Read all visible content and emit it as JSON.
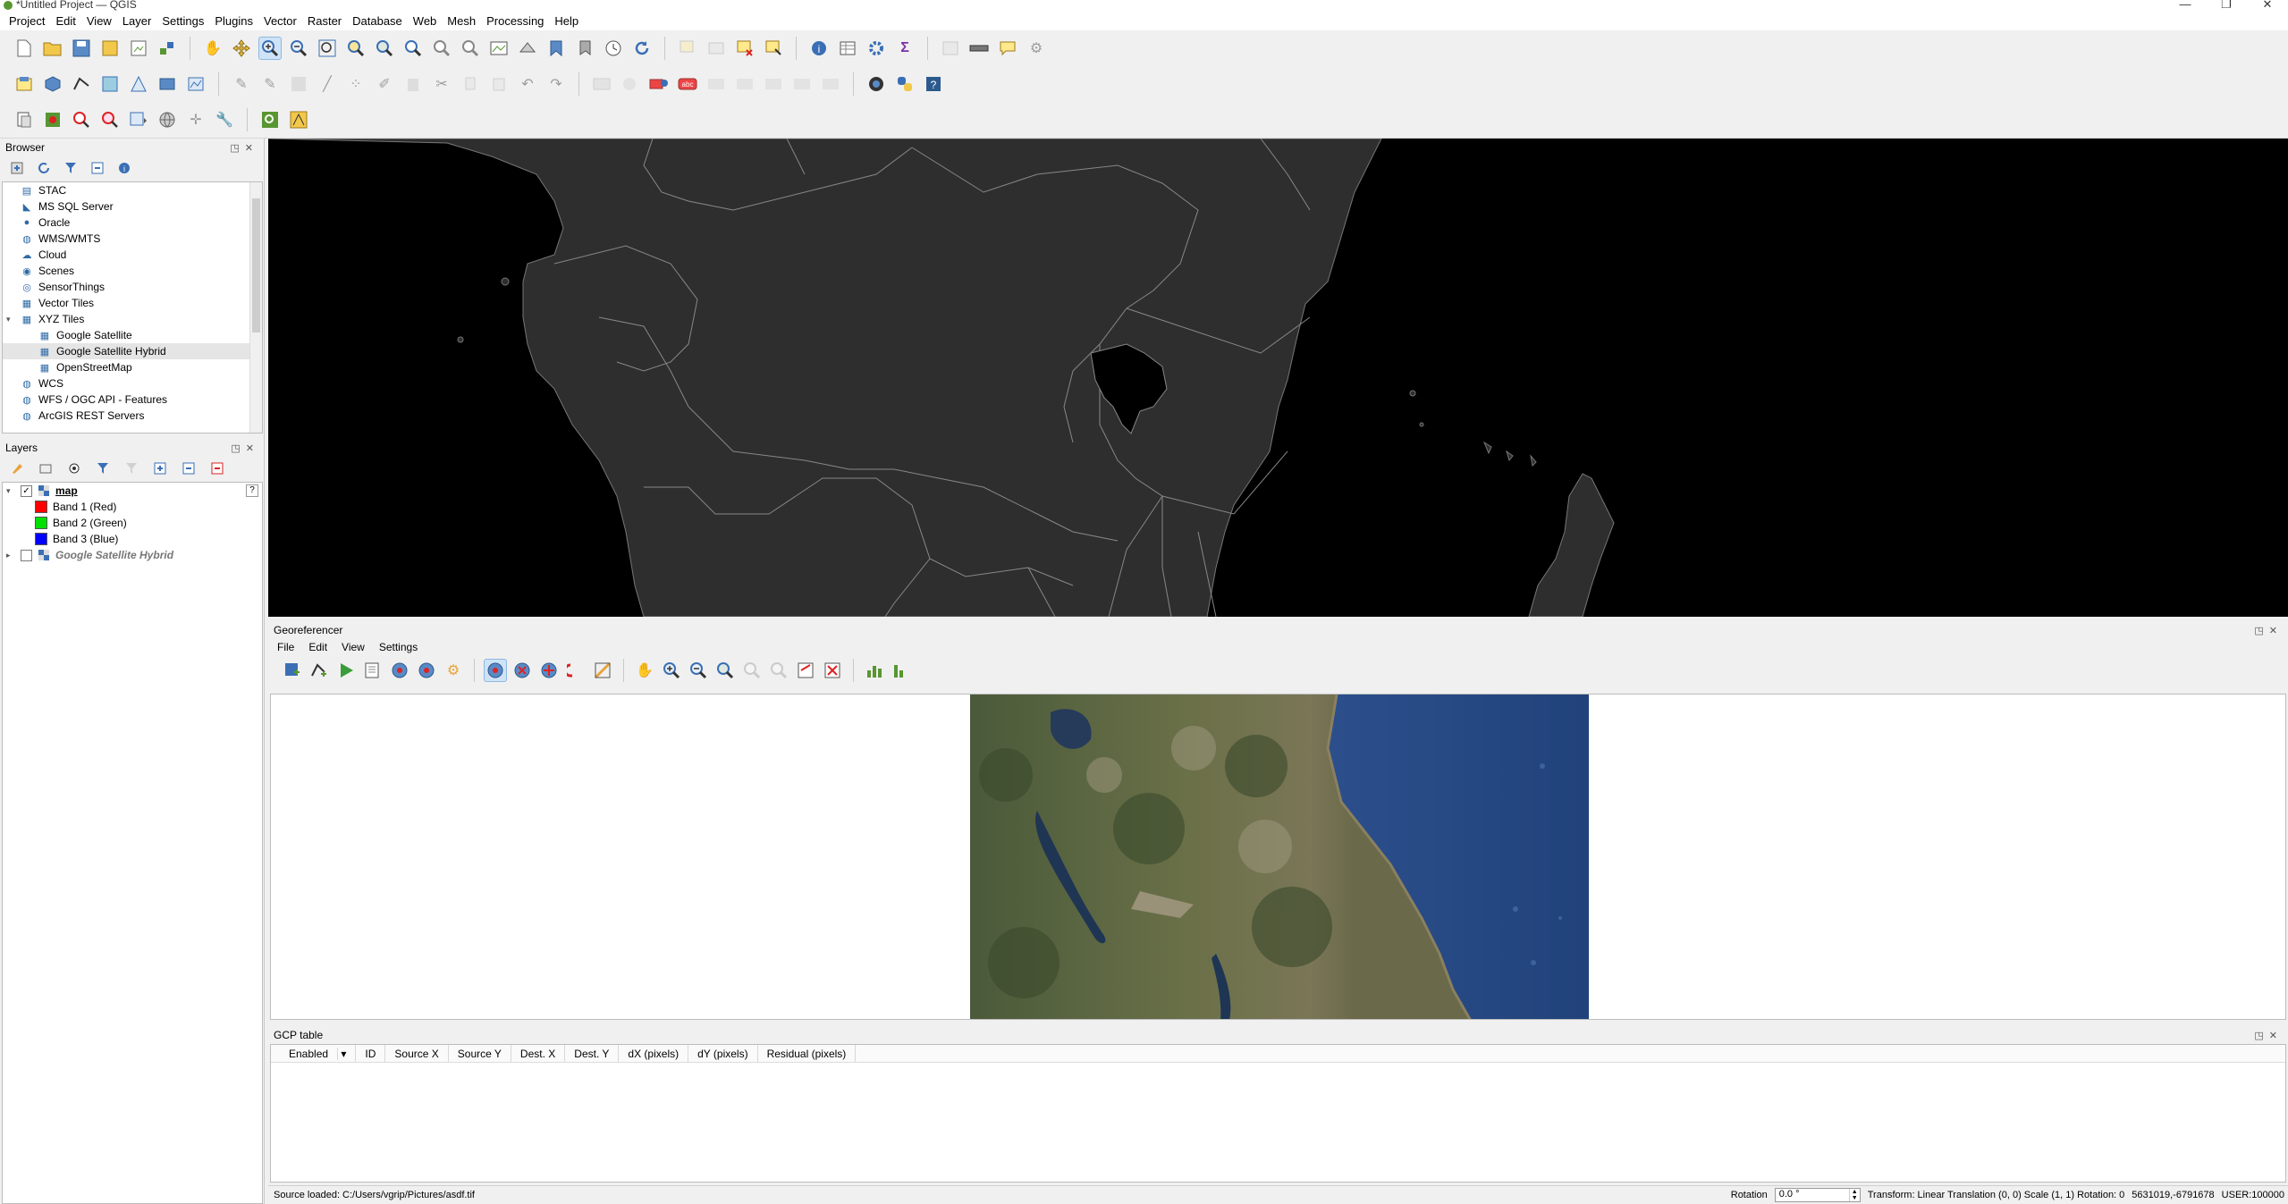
{
  "window": {
    "title": "*Untitled Project — QGIS",
    "controls": [
      "—",
      "❐",
      "✕"
    ]
  },
  "menubar": [
    "Project",
    "Edit",
    "View",
    "Layer",
    "Settings",
    "Plugins",
    "Vector",
    "Raster",
    "Database",
    "Web",
    "Mesh",
    "Processing",
    "Help"
  ],
  "browser": {
    "title": "Browser",
    "items": [
      {
        "label": "STAC",
        "icon": "stac-icon",
        "expand": ""
      },
      {
        "label": "MS SQL Server",
        "icon": "mssql-icon",
        "expand": ""
      },
      {
        "label": "Oracle",
        "icon": "oracle-icon",
        "expand": ""
      },
      {
        "label": "WMS/WMTS",
        "icon": "wms-icon",
        "expand": ""
      },
      {
        "label": "Cloud",
        "icon": "cloud-icon",
        "expand": ""
      },
      {
        "label": "Scenes",
        "icon": "scenes-icon",
        "expand": ""
      },
      {
        "label": "SensorThings",
        "icon": "sensorthings-icon",
        "expand": ""
      },
      {
        "label": "Vector Tiles",
        "icon": "vector-tiles-icon",
        "expand": ""
      },
      {
        "label": "XYZ Tiles",
        "icon": "xyz-tiles-icon",
        "expand": "▾"
      },
      {
        "label": "Google Satellite",
        "icon": "tile-grid-icon",
        "child": true
      },
      {
        "label": "Google Satellite Hybrid",
        "icon": "tile-grid-icon",
        "child": true,
        "selected": true
      },
      {
        "label": "OpenStreetMap",
        "icon": "tile-grid-icon",
        "child": true
      },
      {
        "label": "WCS",
        "icon": "wcs-icon",
        "expand": ""
      },
      {
        "label": "WFS / OGC API - Features",
        "icon": "wfs-icon",
        "expand": ""
      },
      {
        "label": "ArcGIS REST Servers",
        "icon": "arcgis-icon",
        "expand": ""
      }
    ]
  },
  "layers": {
    "title": "Layers",
    "tree": [
      {
        "label": "map",
        "checked": true,
        "bold": true,
        "help": "?"
      },
      {
        "label": "Band 1 (Red)",
        "color": "#ff0000"
      },
      {
        "label": "Band 2 (Green)",
        "color": "#00e000"
      },
      {
        "label": "Band 3 (Blue)",
        "color": "#0000ff"
      },
      {
        "label": "Google Satellite Hybrid",
        "checked": false,
        "italic": true
      }
    ]
  },
  "georeferencer": {
    "title": "Georeferencer",
    "menus": [
      "File",
      "Edit",
      "View",
      "Settings"
    ]
  },
  "gcp": {
    "title": "GCP table",
    "columns": [
      "Enabled",
      "ID",
      "Source X",
      "Source Y",
      "Dest. X",
      "Dest. Y",
      "dX (pixels)",
      "dY (pixels)",
      "Residual (pixels)"
    ]
  },
  "status": {
    "message": "Source loaded: C:/Users/vgrip/Pictures/asdf.tif",
    "rotation_label": "Rotation",
    "rotation_value": "0.0 °",
    "transform": "Transform: Linear Translation (0, 0) Scale (1, 1) Rotation: 0",
    "coords": "5631019,-6791678",
    "crs": "USER:100000"
  },
  "colors": {
    "accent": "#589632",
    "map_land": "#2e2e2e",
    "map_bg": "#000000"
  }
}
